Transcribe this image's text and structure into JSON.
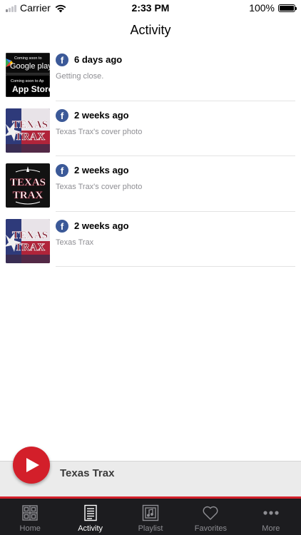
{
  "status": {
    "carrier": "Carrier",
    "time": "2:33 PM",
    "battery": "100%",
    "battery_level": 1.0
  },
  "page": {
    "title": "Activity"
  },
  "activity": [
    {
      "time": "6 days ago",
      "text": "Getting close.",
      "thumb": "app-store-badges",
      "source_icon": "facebook-icon"
    },
    {
      "time": "2 weeks ago",
      "text": "Texas Trax's cover photo",
      "thumb": "texas-trax-flag-logo",
      "source_icon": "facebook-icon"
    },
    {
      "time": "2 weeks ago",
      "text": "Texas Trax's cover photo",
      "thumb": "texas-trax-black-logo",
      "source_icon": "facebook-icon"
    },
    {
      "time": "2 weeks ago",
      "text": "Texas Trax",
      "thumb": "texas-trax-flag-logo",
      "source_icon": "facebook-icon"
    }
  ],
  "badges": {
    "google_top": "Coming soon to",
    "google_bottom": "Google play",
    "apple_top": "Coming soon to Ap",
    "apple_bottom": "App Store"
  },
  "logo": {
    "line1": "TEXAS",
    "line2": "TRAX"
  },
  "player": {
    "title": "Texas Trax",
    "accent": "#d31f2a"
  },
  "tabs": [
    {
      "label": "Home",
      "icon": "home-grid-icon",
      "active": false
    },
    {
      "label": "Activity",
      "icon": "activity-list-icon",
      "active": true
    },
    {
      "label": "Playlist",
      "icon": "playlist-music-icon",
      "active": false
    },
    {
      "label": "Favorites",
      "icon": "heart-icon",
      "active": false
    },
    {
      "label": "More",
      "icon": "more-dots-icon",
      "active": false
    }
  ]
}
